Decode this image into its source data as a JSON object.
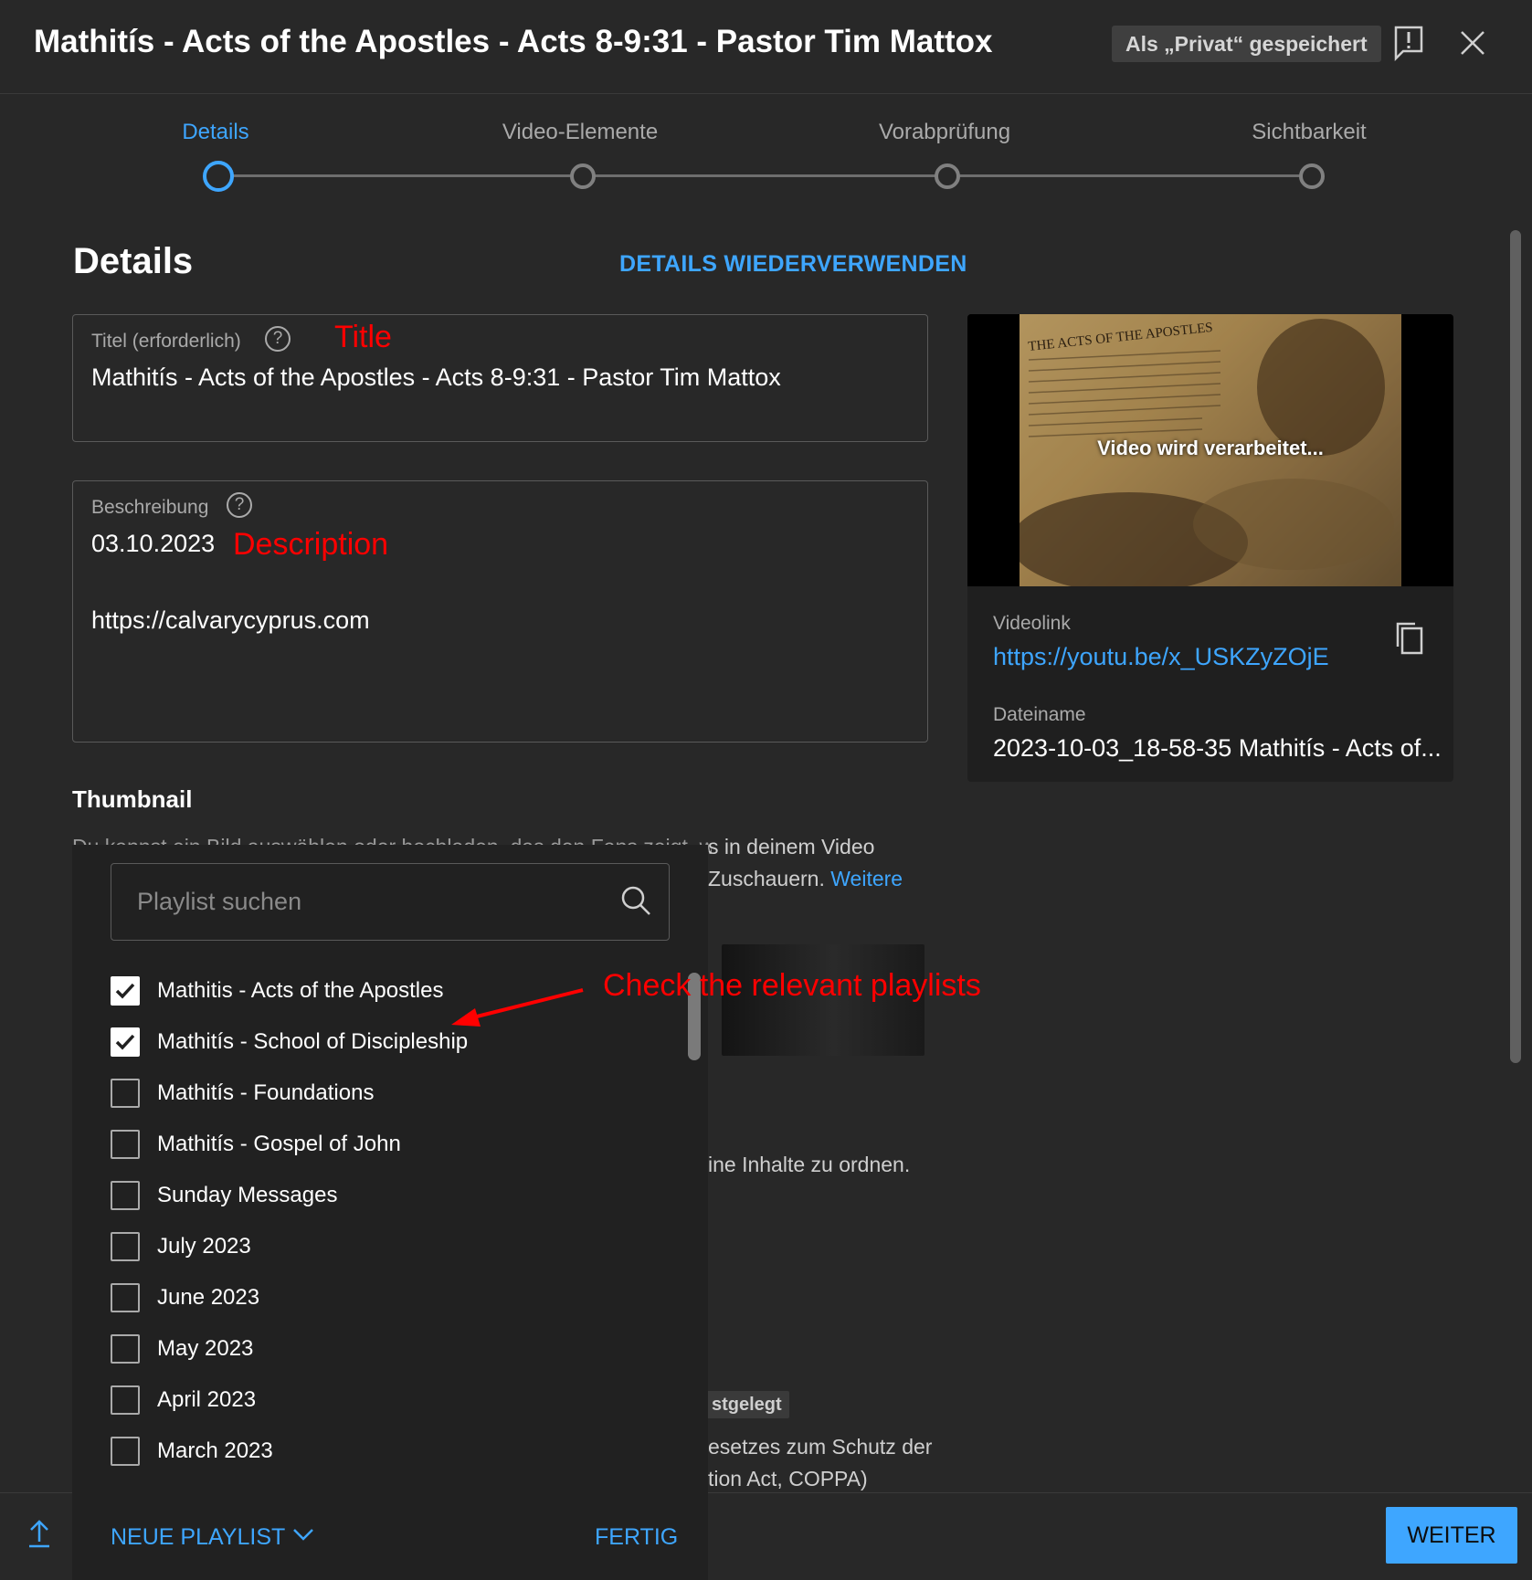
{
  "header": {
    "title": "Mathitís - Acts of the Apostles - Acts 8-9:31 - Pastor Tim Mattox",
    "saved_badge": "Als „Privat“ gespeichert",
    "feedback_icon": "feedback-icon",
    "close_icon": "close-icon"
  },
  "stepper": {
    "steps": [
      {
        "label": "Details",
        "active": true
      },
      {
        "label": "Video-Elemente",
        "active": false
      },
      {
        "label": "Vorabprüfung",
        "active": false
      },
      {
        "label": "Sichtbarkeit",
        "active": false
      }
    ]
  },
  "details": {
    "heading": "Details",
    "reuse_label": "DETAILS WIEDERVERWENDEN",
    "title_field": {
      "label": "Titel (erforderlich)",
      "help": "?",
      "value": "Mathitís - Acts of the Apostles - Acts 8-9:31 - Pastor Tim Mattox"
    },
    "description_field": {
      "label": "Beschreibung",
      "help": "?",
      "line1": "03.10.2023",
      "line2": "https://calvarycyprus.com"
    },
    "thumbnail": {
      "heading": "Thumbnail",
      "text_line1": "Du kannst ein Bild auswählen oder hochladen, das den Fans zeigt, was in deinem Video",
      "text_line1_visible": "s in deinem Video",
      "text_line2_visible": "Zuschauern.",
      "more_link": "Weitere"
    },
    "partial_texts": {
      "playlist_desc": "ine Inhalte zu ordnen.",
      "chip": "stgelegt",
      "coppa_line1": "esetzes zum Schutz der",
      "coppa_line2": "tion Act, COPPA)"
    }
  },
  "annotations": {
    "title": "Title",
    "description": "Description",
    "playlists": "Check the relevant playlists",
    "color": "#ff0000"
  },
  "preview": {
    "processing": "Video wird verarbeitet...",
    "videolink_label": "Videolink",
    "videolink": "https://youtu.be/x_USKZyZOjE",
    "copy_icon": "copy-icon",
    "filename_label": "Dateiname",
    "filename": "2023-10-03_18-58-35 Mathitís - Acts of..."
  },
  "playlist_panel": {
    "search_placeholder": "Playlist suchen",
    "items": [
      {
        "label": "Mathitis - Acts of the Apostles",
        "checked": true
      },
      {
        "label": "Mathitís - School of Discipleship",
        "checked": true
      },
      {
        "label": "Mathitís - Foundations",
        "checked": false
      },
      {
        "label": "Mathitís - Gospel of John",
        "checked": false
      },
      {
        "label": "Sunday Messages",
        "checked": false
      },
      {
        "label": "July 2023",
        "checked": false
      },
      {
        "label": "June 2023",
        "checked": false
      },
      {
        "label": "May 2023",
        "checked": false
      },
      {
        "label": "April 2023",
        "checked": false
      },
      {
        "label": "March 2023",
        "checked": false
      }
    ],
    "new_playlist_label": "NEUE PLAYLIST",
    "done_label": "FERTIG"
  },
  "footer": {
    "next_label": "WEITER",
    "accent": "#3ea6ff"
  }
}
